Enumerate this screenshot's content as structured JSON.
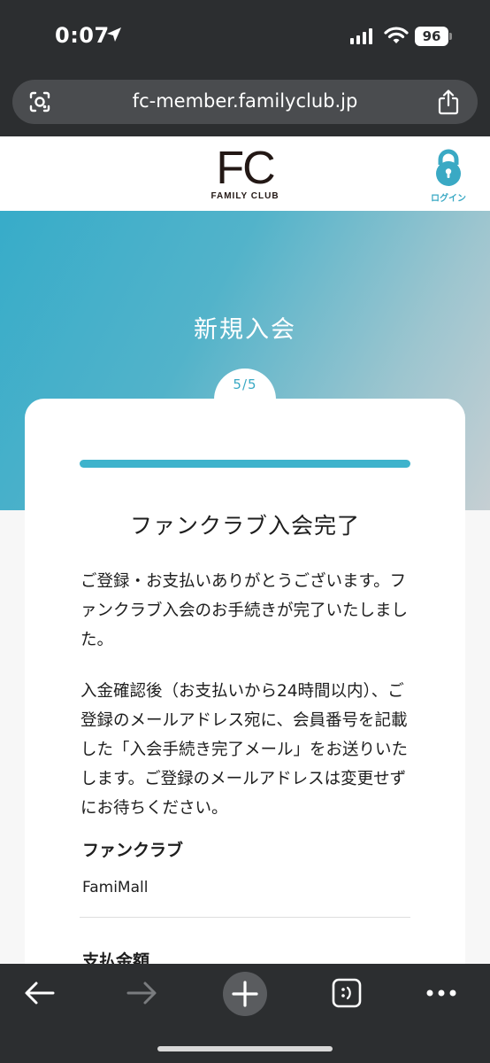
{
  "status_bar": {
    "time": "0:07",
    "battery": "96"
  },
  "browser": {
    "url": "fc-member.familyclub.jp"
  },
  "site_header": {
    "logo_text": "FC",
    "logo_sub": "FAMILY CLUB",
    "login_label": "ログイン"
  },
  "hero": {
    "title": "新規入会"
  },
  "steps": {
    "current": "5/5",
    "progress": 1.0
  },
  "card": {
    "title": "ファンクラブ入会完了",
    "para1": "ご登録・お支払いありがとうございます。ファンクラブ入会のお手続きが完了いたしました。",
    "para2": "入金確認後（お支払いから24時間以内）、ご登録のメールアドレス宛に、会員番号を記載した「入会手続き完了メール」をお送りいたします。ご登録のメールアドレスは変更せずにお待ちください。",
    "fields": [
      {
        "label": "ファンクラブ",
        "value": "FamiMall"
      },
      {
        "label": "支払金額"
      }
    ]
  },
  "colors": {
    "accent": "#3aa9c4",
    "chrome": "#2c2e30"
  },
  "toolbar_icons": [
    "back-arrow-icon",
    "forward-arrow-icon",
    "new-tab-plus-icon",
    "tabs-switcher-icon",
    "more-dots-icon"
  ]
}
